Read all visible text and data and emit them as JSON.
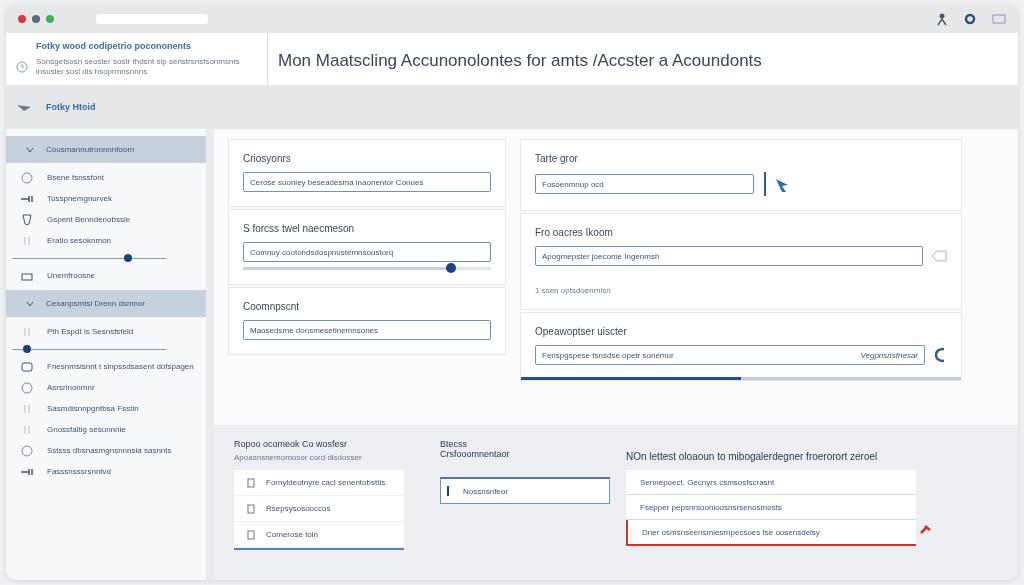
{
  "header": {
    "title": "Fotky wood codipetrio pocononents",
    "subtitle": "Sonsgetsosn seoster sostr thdsnt sip senstrsnsfsonmsnts insusler sosl dis hsoprmnsnnns",
    "heading": "Mon Maatscling Accunonolontes for amts /Accster a Acoundonts"
  },
  "toolbar": {
    "label": "Fotky Htoid"
  },
  "sidebar": [
    {
      "kind": "header",
      "label": "Cousmannutronnnnfoom",
      "selected": true
    },
    {
      "kind": "item",
      "label": "Bsene fsnssfont"
    },
    {
      "kind": "item",
      "label": "Tosspnemgnurvek"
    },
    {
      "kind": "item",
      "label": "Gspent Benndenobssie"
    },
    {
      "kind": "item",
      "label": "Eratio sesoknmon"
    },
    {
      "kind": "slider",
      "level": 0.75
    },
    {
      "kind": "item",
      "label": "Unemfroosne"
    },
    {
      "kind": "header",
      "label": "Cexanpsmtsi Drenn dsmnor",
      "selected": true
    },
    {
      "kind": "item",
      "label": "Pth Espdt is Sesnsfsfeld"
    },
    {
      "kind": "slider",
      "level": 0.1
    },
    {
      "kind": "item",
      "label": "Fnesnmsisnnt t sinpssdsasent dofspagen"
    },
    {
      "kind": "item",
      "label": "Asrsrinonmnr"
    },
    {
      "kind": "item",
      "label": "Sasmdisnnpgntbsa Fsstin"
    },
    {
      "kind": "item",
      "label": "Gnossfaltig sesunnnie"
    },
    {
      "kind": "item",
      "label": "Sstsss dbsnasmgnsnnnsia sasnnts"
    },
    {
      "kind": "item",
      "label": "Fasssnsssrsnntvd"
    }
  ],
  "left_cards": [
    {
      "title": "Criosyonrs",
      "value": "Cerose suoniey beseadesma inaonentor Conues"
    },
    {
      "title": "S forcss twel naecmeson",
      "value": "Comnuy cootondsdospnustemnsoustorq",
      "level": 0.84
    },
    {
      "title": "Coomnpscnt",
      "value": "Maosedsme donsmesetinemnsones"
    }
  ],
  "right_cards": [
    {
      "title": "Tarte gror",
      "value": "Fosoenmnup ocd"
    },
    {
      "title": "Fro oacres Ikoom",
      "value": "Apogmepster joecome Ingenmsh",
      "note": "1 ssen optsdoenmisn"
    },
    {
      "title": "Opeawoptser uiscter",
      "value": "Fenspgspese fsnsdse opetr sonemur",
      "hint": "Vegpnsnsfnesar",
      "level": 0.5
    }
  ],
  "bottom": {
    "col1": {
      "title": "Ropoo ocomeok Co wosfesr",
      "subtitle": "Apoasnsnemomosor cord disdosser",
      "items": [
        "Fornyldeotnyre cacl senentobsttis",
        "Rsepsysosooccos",
        "Comerose toln"
      ]
    },
    "col2": {
      "title": "Btecss",
      "subtitle": "Crsfooomnentaor",
      "item": "Nossnsnfeor"
    },
    "col3": {
      "title": "NOn lettest oloaoun to mibogalerdegner froerorort zeroel",
      "items": [
        {
          "label": "Sennepoect. Gecnyrs csmsosfscrasnt",
          "error": false
        },
        {
          "label": "Fsepper pepsnrsoonioosnsrsenosmosts",
          "error": false
        },
        {
          "label": "Dner osmsnseensmiesrnpecsoes fse oosensdelsy",
          "error": true
        }
      ]
    }
  }
}
